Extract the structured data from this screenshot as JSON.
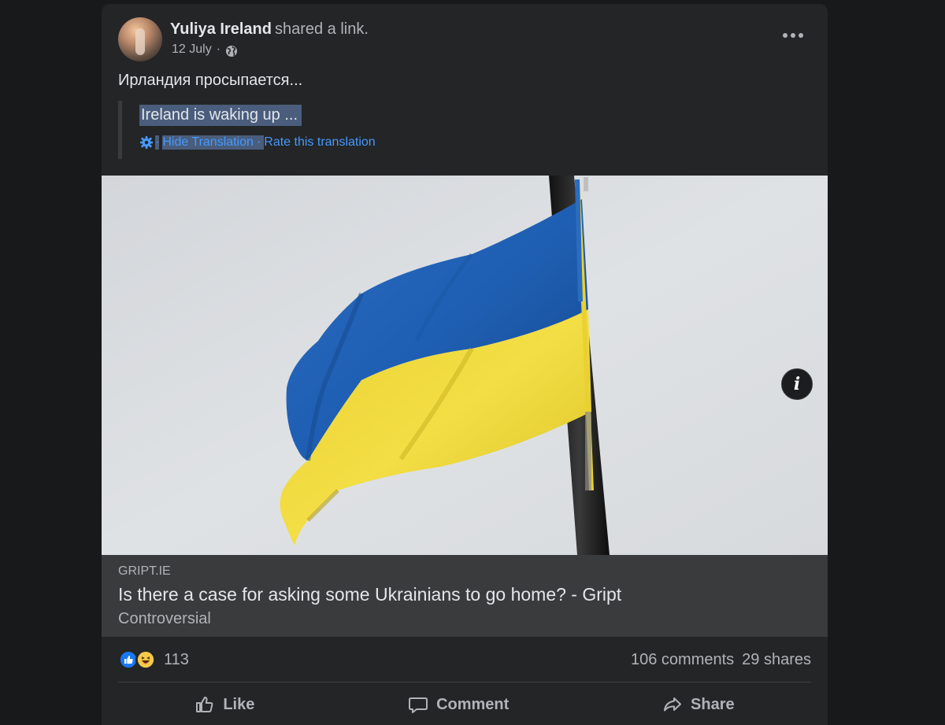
{
  "post": {
    "author": "Yuliya Ireland",
    "action_text": "shared a link.",
    "date": "12 July",
    "separator": "·",
    "text": "Ирландия просыпается...",
    "translation": {
      "text": "Ireland is waking up ...",
      "hide_label": "Hide Translation",
      "rate_label": "Rate this translation",
      "sep": "·"
    }
  },
  "link_preview": {
    "domain": "GRIPT.IE",
    "title": "Is there a case for asking some Ukrainians to go home? - Gript",
    "subtitle": "Controversial"
  },
  "engagement": {
    "reaction_count": "113",
    "comments": "106 comments",
    "shares": "29 shares"
  },
  "actions": {
    "like": "Like",
    "comment": "Comment",
    "share": "Share"
  },
  "colors": {
    "background": "#18191a",
    "card": "#242526",
    "link_blue": "#4599ff",
    "flag_blue": "#1f5fb3",
    "flag_yellow": "#f1dc3a"
  }
}
